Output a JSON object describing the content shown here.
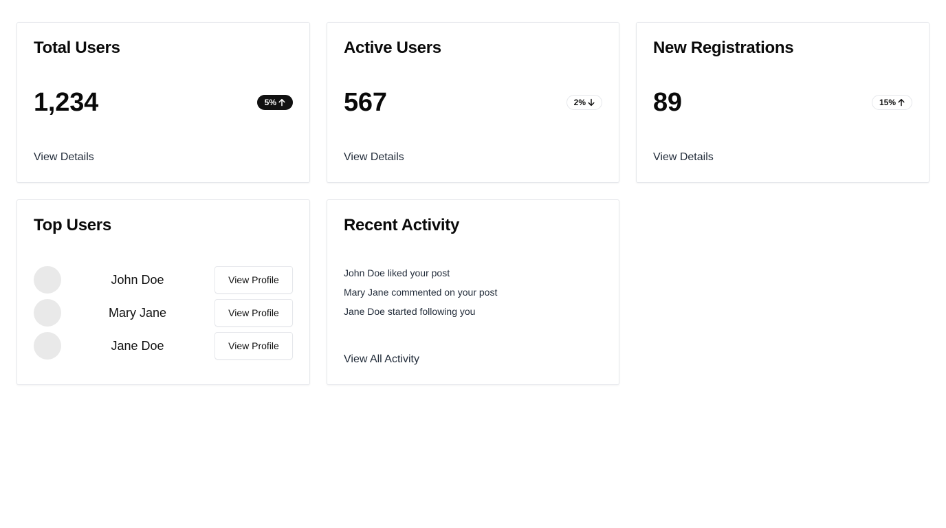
{
  "metrics": [
    {
      "title": "Total Users",
      "value": "1,234",
      "change": "5%",
      "direction": "up",
      "badge_style": "dark",
      "link": "View Details"
    },
    {
      "title": "Active Users",
      "value": "567",
      "change": "2%",
      "direction": "down",
      "badge_style": "light",
      "link": "View Details"
    },
    {
      "title": "New Registrations",
      "value": "89",
      "change": "15%",
      "direction": "up",
      "badge_style": "light",
      "link": "View Details"
    }
  ],
  "top_users": {
    "title": "Top Users",
    "users": [
      {
        "name": "John Doe",
        "button": "View Profile"
      },
      {
        "name": "Mary Jane",
        "button": "View Profile"
      },
      {
        "name": "Jane Doe",
        "button": "View Profile"
      }
    ]
  },
  "recent_activity": {
    "title": "Recent Activity",
    "items": [
      "John Doe liked your post",
      "Mary Jane commented on your post",
      "Jane Doe started following you"
    ],
    "link": "View All Activity"
  },
  "colors": {
    "badge_dark_bg": "#111111",
    "border": "#e5e7eb",
    "avatar_placeholder": "#e9e9e9"
  },
  "icons": {
    "up": "arrow-up-icon",
    "down": "arrow-down-icon"
  }
}
